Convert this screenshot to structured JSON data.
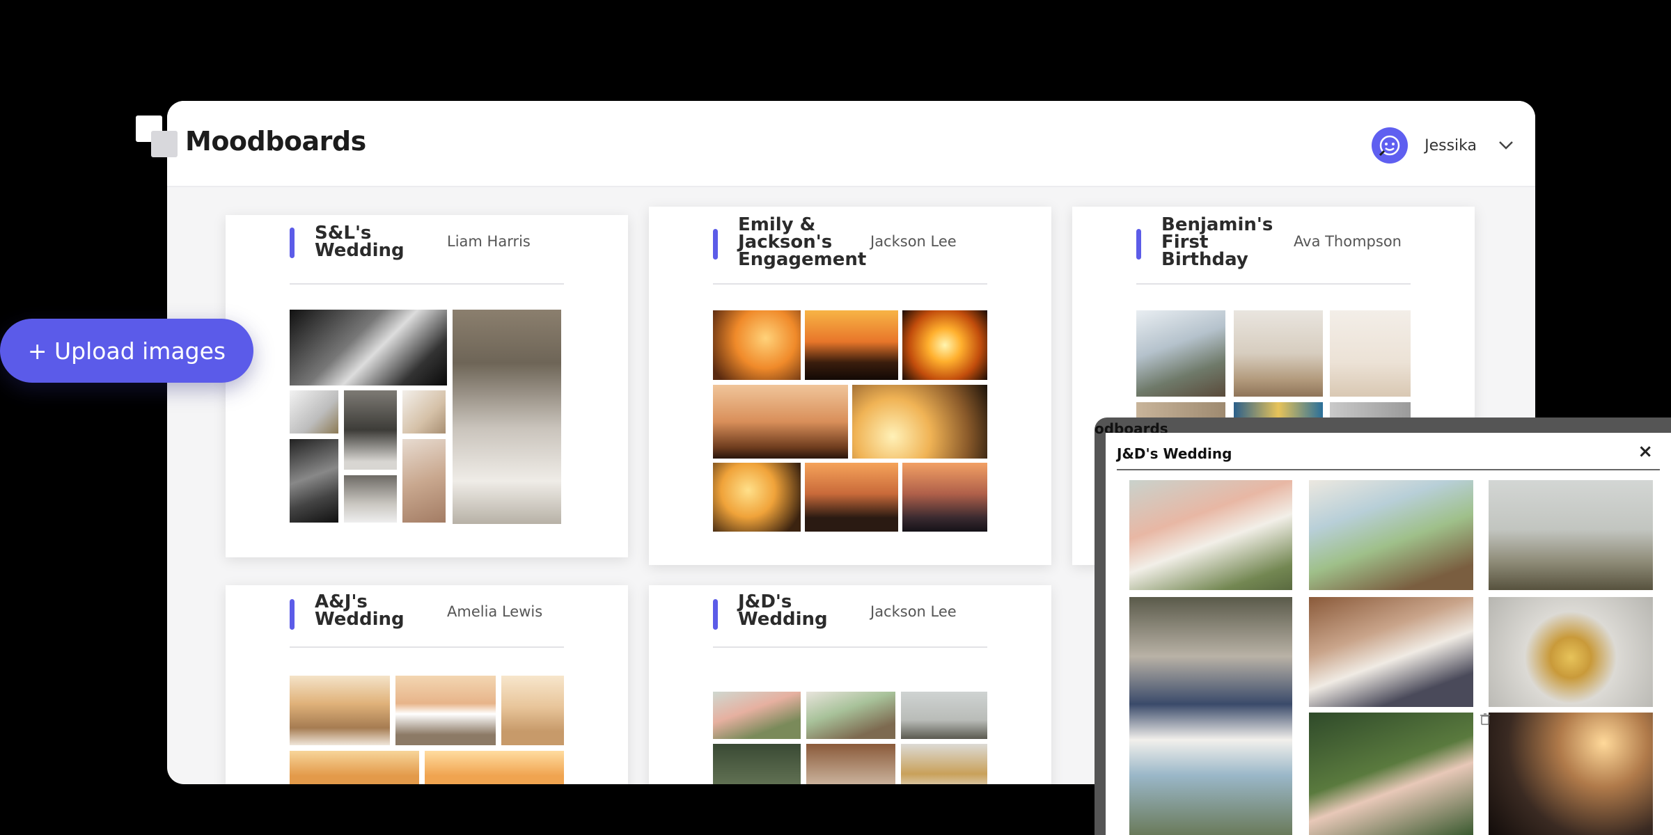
{
  "app": {
    "title": "Moodboards",
    "user": "Jessika"
  },
  "upload_button": "+ Upload images",
  "cards": [
    {
      "title_lines": [
        "S&L's",
        "Wedding"
      ],
      "owner": "Liam Harris"
    },
    {
      "title_lines": [
        "Emily &",
        "Jackson's",
        "Engagement"
      ],
      "owner": "Jackson Lee"
    },
    {
      "title_lines": [
        "Benjamin's",
        "First",
        "Birthday"
      ],
      "owner": "Ava Thompson"
    },
    {
      "title_lines": [
        "A&J's",
        "Wedding"
      ],
      "owner": "Amelia Lewis"
    },
    {
      "title_lines": [
        "J&D's",
        "Wedding"
      ],
      "owner": "Jackson Lee"
    }
  ],
  "overlay": {
    "back_label": "odboards",
    "title": "J&D's Wedding",
    "close": "×"
  },
  "colors": {
    "accent": "#5b5be9",
    "background": "#000000"
  }
}
